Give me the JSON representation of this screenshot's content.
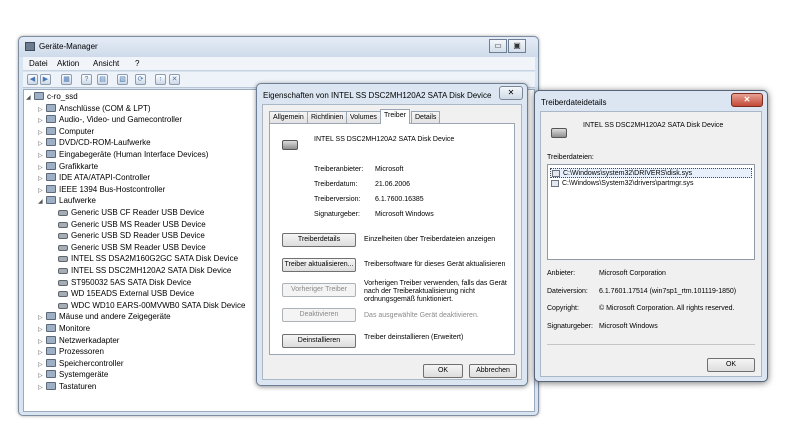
{
  "device_manager": {
    "title": "Geräte-Manager",
    "caption_buttons": [
      "▭",
      "▣"
    ],
    "menu": [
      "Datei",
      "Aktion",
      "Ansicht",
      "?"
    ],
    "toolbar_icons": [
      "back-icon",
      "forward-icon",
      "properties-icon",
      "help-icon",
      "show-hidden-icon",
      "refresh-icon",
      "scan-hardware-icon",
      "update-driver-icon",
      "uninstall-icon"
    ],
    "toolbar_glyphs": [
      "◀",
      "▶",
      "▦",
      "?",
      "▤",
      "▧",
      "⟳",
      "↑",
      "✕"
    ],
    "tree": [
      {
        "label": "c-ro_ssd",
        "level": 0,
        "expand": "◢"
      },
      {
        "label": "Anschlüsse (COM & LPT)",
        "level": 1,
        "expand": "▷"
      },
      {
        "label": "Audio-, Video- und Gamecontroller",
        "level": 1,
        "expand": "▷"
      },
      {
        "label": "Computer",
        "level": 1,
        "expand": "▷"
      },
      {
        "label": "DVD/CD-ROM-Laufwerke",
        "level": 1,
        "expand": "▷"
      },
      {
        "label": "Eingabegeräte (Human Interface Devices)",
        "level": 1,
        "expand": "▷"
      },
      {
        "label": "Grafikkarte",
        "level": 1,
        "expand": "▷"
      },
      {
        "label": "IDE ATA/ATAPI-Controller",
        "level": 1,
        "expand": "▷"
      },
      {
        "label": "IEEE 1394 Bus-Hostcontroller",
        "level": 1,
        "expand": "▷"
      },
      {
        "label": "Laufwerke",
        "level": 1,
        "expand": "◢"
      },
      {
        "label": "Generic USB CF Reader USB Device",
        "level": 2,
        "expand": ""
      },
      {
        "label": "Generic USB MS Reader USB Device",
        "level": 2,
        "expand": ""
      },
      {
        "label": "Generic USB SD Reader USB Device",
        "level": 2,
        "expand": ""
      },
      {
        "label": "Generic USB SM Reader USB Device",
        "level": 2,
        "expand": ""
      },
      {
        "label": "INTEL SS DSA2M160G2GC SATA Disk Device",
        "level": 2,
        "expand": ""
      },
      {
        "label": "INTEL SS DSC2MH120A2 SATA Disk Device",
        "level": 2,
        "expand": ""
      },
      {
        "label": "ST950032 5AS SATA Disk Device",
        "level": 2,
        "expand": ""
      },
      {
        "label": "WD 15EADS External USB Device",
        "level": 2,
        "expand": ""
      },
      {
        "label": "WDC WD10 EARS-00MVWB0 SATA Disk Device",
        "level": 2,
        "expand": ""
      },
      {
        "label": "Mäuse und andere Zeigegeräte",
        "level": 1,
        "expand": "▷"
      },
      {
        "label": "Monitore",
        "level": 1,
        "expand": "▷"
      },
      {
        "label": "Netzwerkadapter",
        "level": 1,
        "expand": "▷"
      },
      {
        "label": "Prozessoren",
        "level": 1,
        "expand": "▷"
      },
      {
        "label": "Speichercontroller",
        "level": 1,
        "expand": "▷"
      },
      {
        "label": "Systemgeräte",
        "level": 1,
        "expand": "▷"
      },
      {
        "label": "Tastaturen",
        "level": 1,
        "expand": "▷"
      }
    ]
  },
  "properties": {
    "title": "Eigenschaften von INTEL SS DSC2MH120A2 SATA Disk Device",
    "close": "✕",
    "tabs": [
      "Allgemein",
      "Richtlinien",
      "Volumes",
      "Treiber",
      "Details"
    ],
    "active_tab": "Treiber",
    "device_name": "INTEL SS DSC2MH120A2 SATA Disk Device",
    "fields": [
      {
        "label": "Treiberanbieter:",
        "value": "Microsoft"
      },
      {
        "label": "Treiberdatum:",
        "value": "21.06.2006"
      },
      {
        "label": "Treiberversion:",
        "value": "6.1.7600.16385"
      },
      {
        "label": "Signaturgeber:",
        "value": "Microsoft Windows"
      }
    ],
    "actions": [
      {
        "button": "Treiberdetails",
        "desc": "Einzelheiten über Treiberdateien anzeigen",
        "disabled": false
      },
      {
        "button": "Treiber aktualisieren...",
        "desc": "Treibersoftware für dieses Gerät aktualisieren",
        "disabled": false
      },
      {
        "button": "Vorheriger Treiber",
        "desc": "Vorherigen Treiber verwenden, falls das Gerät nach der Treiberaktualisierung nicht ordnungsgemäß funktioniert.",
        "disabled": true
      },
      {
        "button": "Deaktivieren",
        "desc": "Das ausgewählte Gerät deaktivieren.",
        "disabled": true
      },
      {
        "button": "Deinstallieren",
        "desc": "Treiber deinstallieren (Erweitert)",
        "disabled": false
      }
    ],
    "ok": "OK",
    "cancel": "Abbrechen"
  },
  "file_details": {
    "title": "Treiberdateidetails",
    "close": "✕",
    "device_name": "INTEL SS DSC2MH120A2 SATA Disk Device",
    "files_label": "Treiberdateien:",
    "files": [
      "C:\\Windows\\system32\\DRIVERS\\disk.sys",
      "C:\\Windows\\System32\\drivers\\partmgr.sys"
    ],
    "selected_file_index": 0,
    "info": [
      {
        "label": "Anbieter:",
        "value": "Microsoft Corporation"
      },
      {
        "label": "Dateiversion:",
        "value": "6.1.7601.17514 (win7sp1_rtm.101119-1850)"
      },
      {
        "label": "Copyright:",
        "value": "© Microsoft Corporation. All rights reserved."
      },
      {
        "label": "Signaturgeber:",
        "value": "Microsoft Windows"
      }
    ],
    "ok": "OK"
  }
}
